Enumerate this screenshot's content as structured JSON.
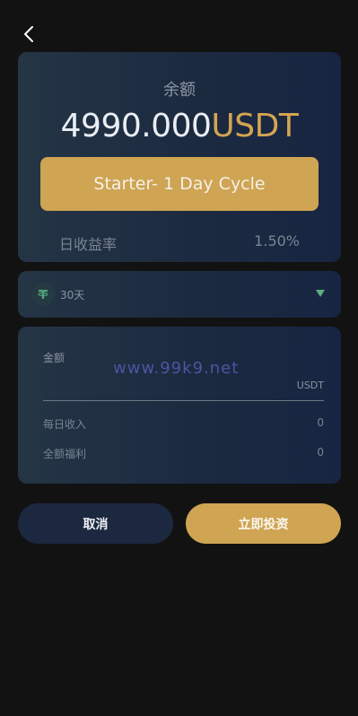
{
  "header": {
    "back_icon": "chevron-left-icon"
  },
  "balance": {
    "label": "余额",
    "amount": "4990.000",
    "unit": "USDT",
    "plan_button": "Starter- 1 Day Cycle",
    "rate_label": "日收益率",
    "rate_value": "1.50%"
  },
  "cycle": {
    "icon": "tether-icon",
    "label": "30天",
    "dropdown_icon": "caret-down-icon"
  },
  "form": {
    "amount_label": "金额",
    "amount_value": "",
    "amount_unit": "USDT",
    "watermark": "www.99k9.net",
    "daily_income_label": "每日收入",
    "daily_income_value": "0",
    "total_benefit_label": "全额福利",
    "total_benefit_value": "0"
  },
  "actions": {
    "cancel_label": "取消",
    "invest_label": "立即投资"
  },
  "colors": {
    "background": "#121212",
    "accent_gold": "#cfa452",
    "card_dark": "#1c2a40",
    "caret_green": "#5fae7e"
  }
}
